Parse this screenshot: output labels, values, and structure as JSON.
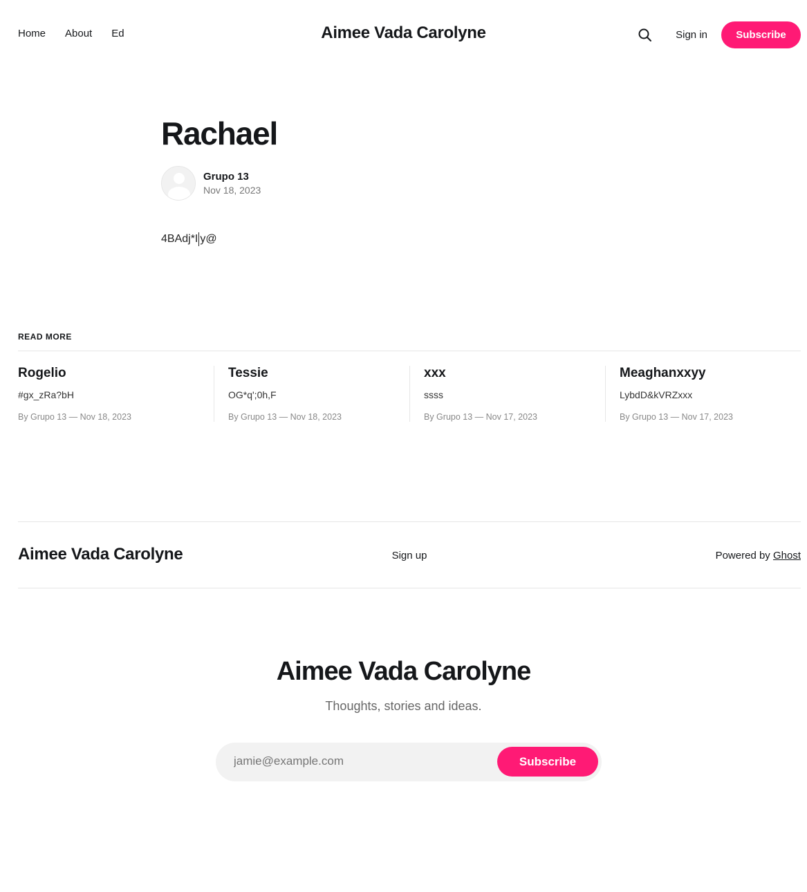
{
  "header": {
    "nav": [
      "Home",
      "About",
      "Ed"
    ],
    "site_title": "Aimee Vada Carolyne",
    "signin_label": "Sign in",
    "subscribe_label": "Subscribe"
  },
  "article": {
    "title": "Rachael",
    "author": "Grupo 13",
    "date": "Nov 18, 2023",
    "content_before": "4BAdj*I",
    "content_after": "y@"
  },
  "read_more": {
    "label": "READ MORE",
    "posts": [
      {
        "title": "Rogelio",
        "excerpt": "#gx_zRa?bH",
        "meta": "By Grupo 13 — Nov 18, 2023"
      },
      {
        "title": "Tessie",
        "excerpt": "OG*q';0h,F",
        "meta": "By Grupo 13 — Nov 18, 2023"
      },
      {
        "title": "xxx",
        "excerpt": "ssss",
        "meta": "By Grupo 13 — Nov 17, 2023"
      },
      {
        "title": "Meaghanxxyy",
        "excerpt": "LybdD&kVRZxxx",
        "meta": "By Grupo 13 — Nov 17, 2023"
      }
    ]
  },
  "footer": {
    "title": "Aimee Vada Carolyne",
    "signup_label": "Sign up",
    "powered_prefix": "Powered by",
    "powered_link": "Ghost"
  },
  "cta": {
    "title": "Aimee Vada Carolyne",
    "description": "Thoughts, stories and ideas.",
    "email_placeholder": "jamie@example.com",
    "button_label": "Subscribe"
  },
  "colors": {
    "accent": "#ff1a75",
    "text": "#15171a"
  },
  "icons": {
    "search": "search-icon",
    "avatar": "avatar-icon"
  }
}
